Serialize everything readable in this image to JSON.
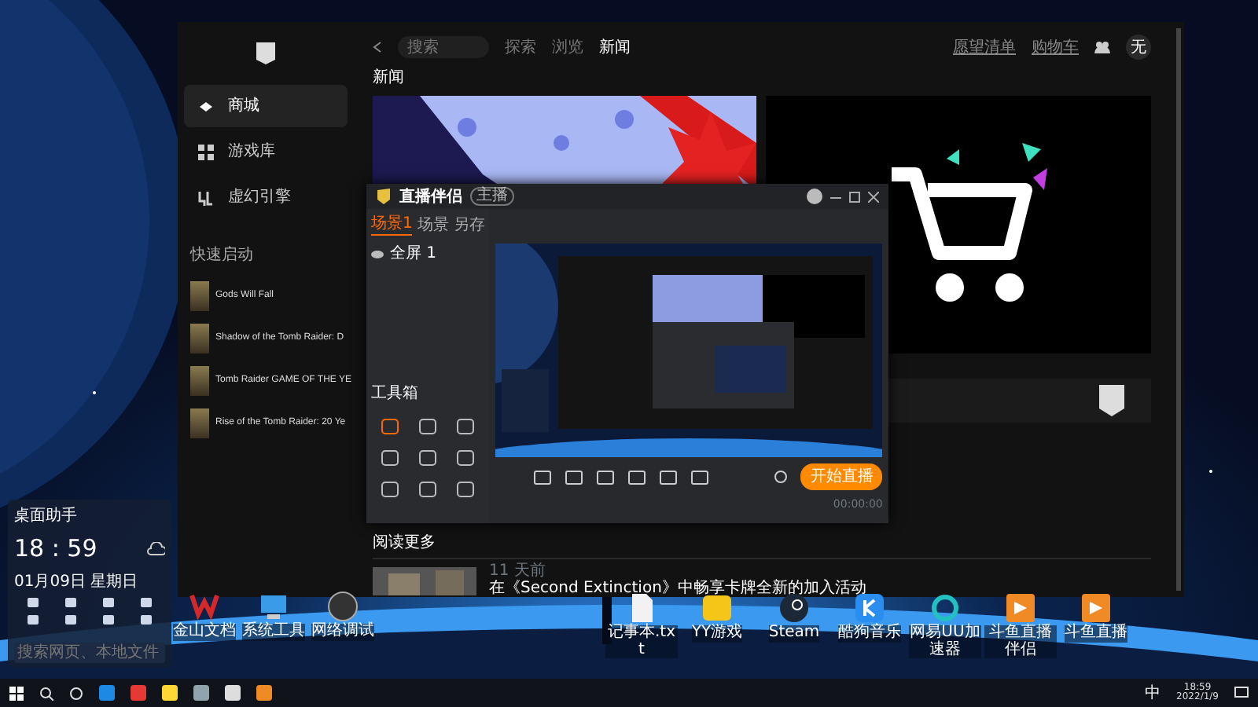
{
  "epic": {
    "nav": [
      {
        "label": "商城",
        "selected": true
      },
      {
        "label": "游戏库",
        "selected": false
      },
      {
        "label": "虚幻引擎",
        "selected": false
      }
    ],
    "quick_launch_title": "快速启动",
    "quick_launch": [
      "Gods Will Fall",
      "Shadow of the Tomb Raider: D",
      "Tomb Raider GAME OF THE YE",
      "Rise of the Tomb Raider: 20 Ye"
    ],
    "search": {
      "placeholder": "搜索"
    },
    "tabs": [
      {
        "label": "探索",
        "selected": false
      },
      {
        "label": "浏览",
        "selected": false
      },
      {
        "label": "新闻",
        "selected": true
      }
    ],
    "header_links": [
      "愿望清单",
      "购物车"
    ],
    "avatar": "无",
    "section_title": "新闻",
    "read_more": "阅读更多",
    "news": [
      {
        "age": "11 天前",
        "title": "在《Second Extinction》中畅享卡牌全新的加入活动"
      }
    ]
  },
  "streamer": {
    "title": "直播伴侣",
    "badge": "主播",
    "scene_tabs": [
      {
        "label": "场景1",
        "selected": true
      },
      {
        "label": "场景",
        "selected": false
      },
      {
        "label": "另存",
        "selected": false
      }
    ],
    "source": "全屏 1",
    "toolbox_title": "工具箱",
    "start_button": "开始直播",
    "timer": "00:00:00"
  },
  "widget": {
    "title": "桌面助手",
    "time": "18 : 59",
    "date": "01月09日 星期日",
    "search": {
      "placeholder": "搜索网页、本地文件"
    }
  },
  "desktop_icons": [
    {
      "label": "金山文档",
      "kind": "wps"
    },
    {
      "label": "系统工具",
      "kind": "pc"
    },
    {
      "label": "网络调试",
      "kind": "globe"
    },
    {
      "label": "记事本.txt",
      "kind": "doc"
    },
    {
      "label": "YY游戏",
      "kind": "yy"
    },
    {
      "label": "Steam",
      "kind": "steam"
    },
    {
      "label": "酷狗音乐",
      "kind": "kugou"
    },
    {
      "label": "网易UU加速器",
      "kind": "uu"
    },
    {
      "label": "斗鱼直播伴侣",
      "kind": "fish"
    },
    {
      "label": "斗鱼直播",
      "kind": "fish"
    }
  ],
  "taskbar": {
    "ime": "中",
    "time": "18:59",
    "date": "2022/1/9"
  }
}
